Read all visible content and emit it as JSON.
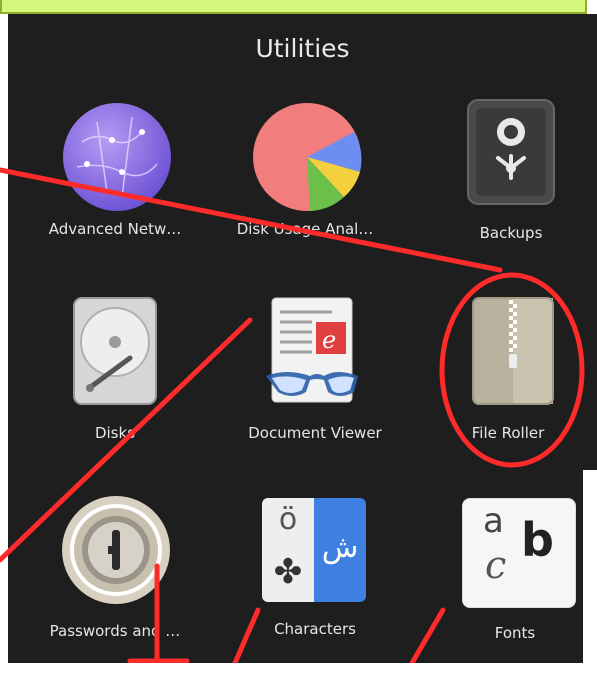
{
  "header": {
    "title": "Utilities"
  },
  "apps": [
    {
      "label": "Advanced Netw…",
      "icon": "globe-network-icon"
    },
    {
      "label": "Disk Usage Anal…",
      "icon": "pie-chart-icon"
    },
    {
      "label": "Backups",
      "icon": "safe-icon"
    },
    {
      "label": "Disks",
      "icon": "hard-drive-icon"
    },
    {
      "label": "Document Viewer",
      "icon": "document-glasses-icon"
    },
    {
      "label": "File Roller",
      "icon": "zipper-archive-icon"
    },
    {
      "label": "Passwords and …",
      "icon": "password-keyhole-icon"
    },
    {
      "label": "Characters",
      "icon": "characters-icon"
    },
    {
      "label": "Fonts",
      "icon": "fonts-icon"
    }
  ],
  "glyphs": {
    "characters_left": "ö",
    "characters_right": "ش",
    "characters_symbol": "✤",
    "fonts_a": "a",
    "fonts_b": "b",
    "fonts_c": "c"
  },
  "colors": {
    "annotation": "#ff2a2a",
    "panel_bg": "#1e1e1e",
    "banner": "#d4f77c"
  }
}
